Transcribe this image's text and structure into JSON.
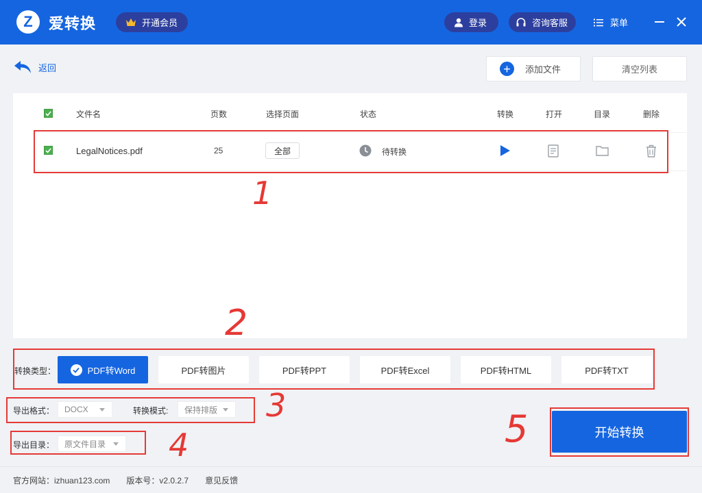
{
  "app": {
    "logo_letter": "Z",
    "name": "爱转换"
  },
  "titlebar": {
    "vip_label": "开通会员",
    "login_label": "登录",
    "service_label": "咨询客服",
    "menu_label": "菜单"
  },
  "toolbar": {
    "back_label": "返回",
    "add_file_label": "添加文件",
    "clear_list_label": "清空列表"
  },
  "table": {
    "headers": {
      "filename": "文件名",
      "pages": "页数",
      "select_pages": "选择页面",
      "status": "状态",
      "convert": "转换",
      "open": "打开",
      "folder": "目录",
      "delete": "删除"
    },
    "rows": [
      {
        "filename": "LegalNotices.pdf",
        "pages": "25",
        "select_pages": "全部",
        "status": "待转换",
        "checked": true
      }
    ]
  },
  "conversion": {
    "label": "转换类型：",
    "types": [
      "PDF转Word",
      "PDF转图片",
      "PDF转PPT",
      "PDF转Excel",
      "PDF转HTML",
      "PDF转TXT"
    ],
    "selected": "PDF转Word"
  },
  "options": {
    "format_label": "导出格式：",
    "format_value": "DOCX",
    "mode_label": "转换模式:",
    "mode_value": "保持排版",
    "dir_label": "导出目录：",
    "dir_value": "原文件目录"
  },
  "start_button_label": "开始转换",
  "footer": {
    "website": "官方网站：izhuan123.com",
    "version": "版本号：v2.0.2.7",
    "feedback": "意见反馈"
  },
  "annotations": [
    "1",
    "2",
    "3",
    "4",
    "5"
  ],
  "colors": {
    "primary": "#1565e0",
    "vip_pill": "#2c3f9e",
    "annotation": "#e53935",
    "check": "#4caf50"
  }
}
